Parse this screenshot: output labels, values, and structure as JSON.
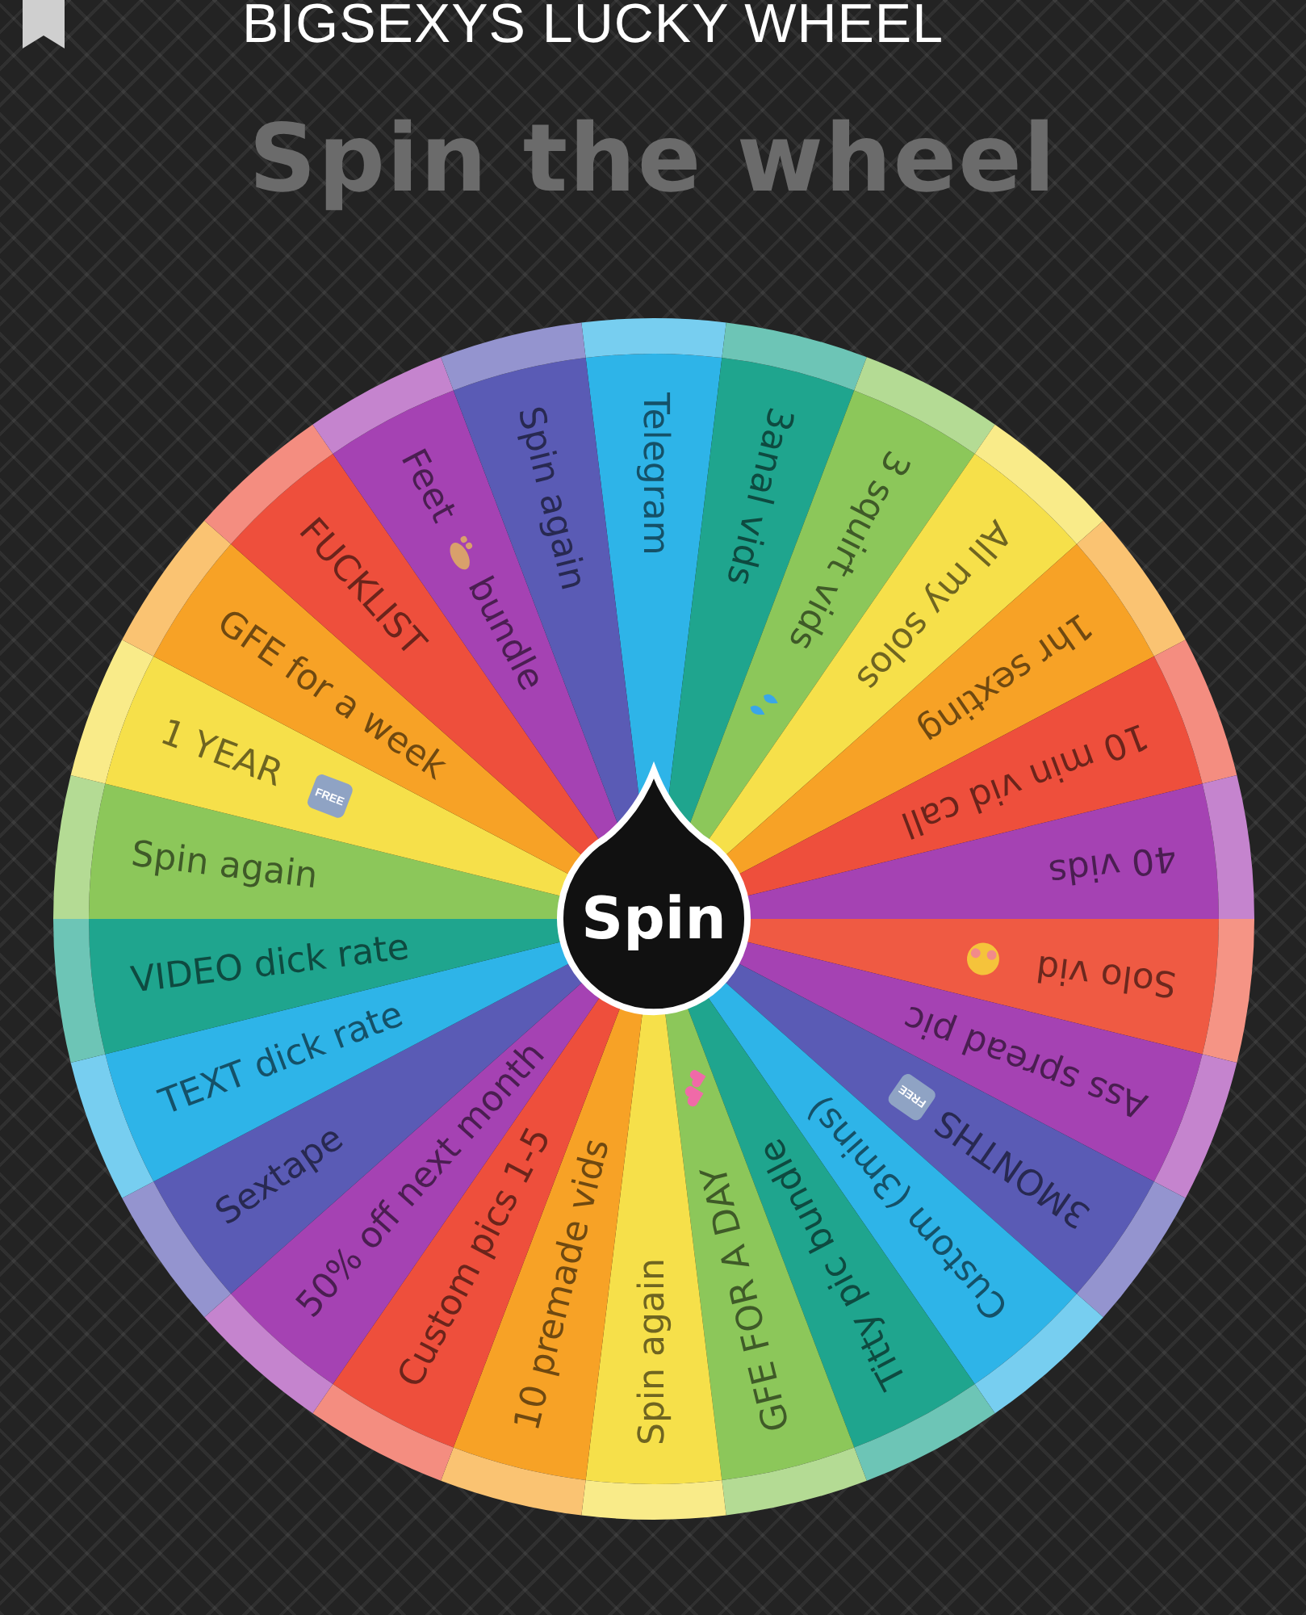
{
  "header": {
    "title": "BIGSEXYS LUCKY WHEEL"
  },
  "subtitle": "Spin the wheel",
  "wheel": {
    "button": "Spin",
    "slices": [
      {
        "label": "Telegram",
        "color": "#2eb4e8"
      },
      {
        "label": "3anal vids",
        "color": "#1fa58e"
      },
      {
        "label": "3 squirt vids",
        "color": "#8cc75a",
        "kind": "drops"
      },
      {
        "label": "All my solos",
        "color": "#f6e04a"
      },
      {
        "label": "1hr sexting",
        "color": "#f7a226"
      },
      {
        "label": "10 min vid call",
        "color": "#ee4f3c"
      },
      {
        "label": "40 vids",
        "color": "#a542b3"
      },
      {
        "label": "Solo vid",
        "color": "#ef5a43",
        "kind": "blush"
      },
      {
        "label": "Ass spread pic",
        "color": "#a542b3"
      },
      {
        "label": "3MONTHS",
        "color": "#5a5bb5",
        "badge": "FREE"
      },
      {
        "label": "Custom (3mins)",
        "color": "#2eb4e8"
      },
      {
        "label": "Titty pic bundle",
        "color": "#1fa58e"
      },
      {
        "label": "GFE FOR A DAY",
        "color": "#8cc75a",
        "kind": "hearts"
      },
      {
        "label": "Spin again",
        "color": "#f6e04a"
      },
      {
        "label": "10 premade vids",
        "color": "#f7a226"
      },
      {
        "label": "Custom pics 1-5",
        "color": "#ee4f3c"
      },
      {
        "label": "50% off next month",
        "color": "#a542b3"
      },
      {
        "label": "Sextape",
        "color": "#5a5bb5"
      },
      {
        "label": "TEXT dick rate",
        "color": "#2eb4e8"
      },
      {
        "label": "VIDEO dick rate",
        "color": "#1fa58e"
      },
      {
        "label": "Spin again",
        "color": "#8cc75a"
      },
      {
        "label": "1 YEAR",
        "color": "#f6e04a",
        "badge": "FREE"
      },
      {
        "label": "GFE for a week",
        "color": "#f7a226"
      },
      {
        "label": "FUCKLIST",
        "color": "#ee4f3c"
      },
      {
        "label": "Feet",
        "color": "#a542b3",
        "kind": "foot",
        "after": "bundle"
      },
      {
        "label": "Spin again",
        "color": "#5a5bb5"
      }
    ]
  }
}
